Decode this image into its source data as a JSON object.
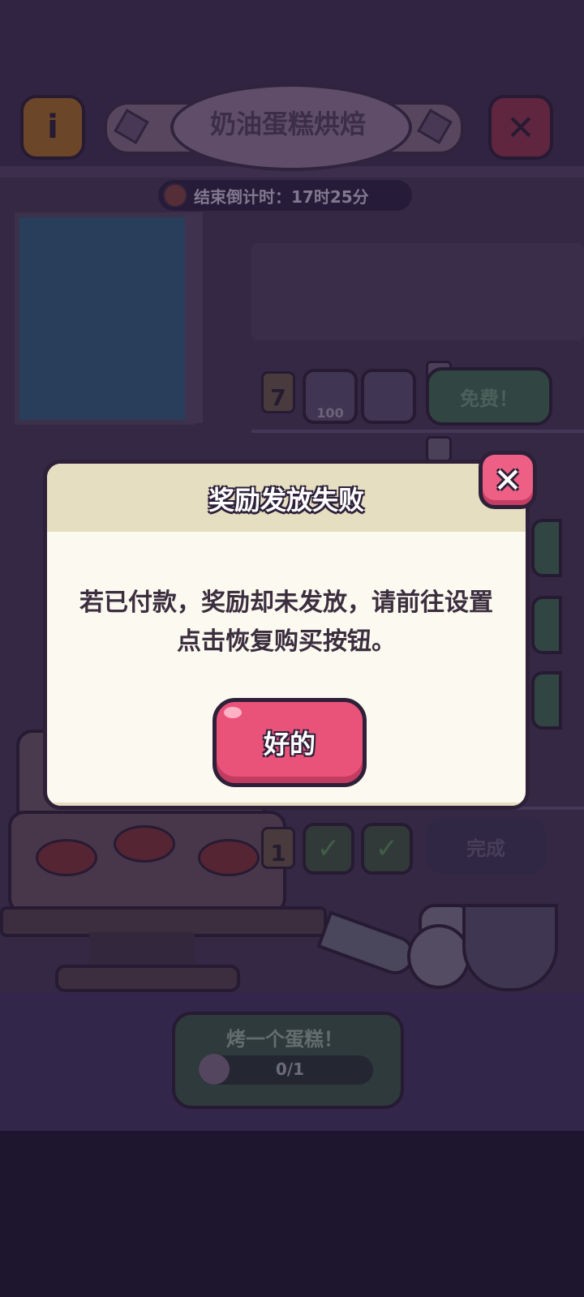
{
  "header": {
    "title": "奶油蛋糕烘焙",
    "info_label": "i",
    "close_label": "✕",
    "countdown": "结束倒计时：17时25分"
  },
  "rewards": {
    "row7": {
      "level": "7",
      "item_count": "100",
      "button": "免费！"
    },
    "row1": {
      "level": "1",
      "button": "完成",
      "check": "✓"
    }
  },
  "quest": {
    "title": "烤一个蛋糕！",
    "progress": "0/1"
  },
  "dialog": {
    "title": "奖励发放失败",
    "message": "若已付款，奖励却未发放，请前往设置点击恢复购买按钮。",
    "ok_label": "好的",
    "close_label": "✕"
  },
  "icons": [
    "info-icon",
    "close-icon",
    "timer-icon",
    "lock-icon",
    "check-icon",
    "cake-icon"
  ],
  "colors": {
    "accent_pink": "#e9537a",
    "dialog_bg": "#fbf9f0",
    "dialog_header": "#e6dec0",
    "outline": "#2d2038"
  }
}
